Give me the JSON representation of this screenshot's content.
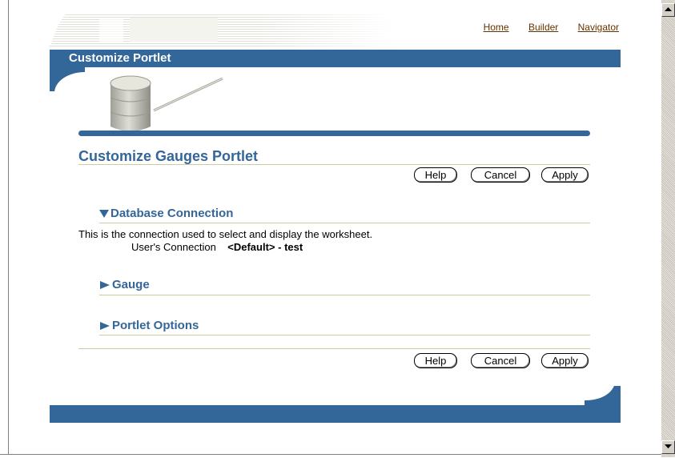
{
  "nav": {
    "home": "Home",
    "builder": "Builder",
    "navigator": "Navigator"
  },
  "title_bar": "Customize Portlet",
  "page_heading": "Customize Gauges Portlet",
  "buttons": {
    "help": "Help",
    "cancel": "Cancel",
    "apply": "Apply"
  },
  "sections": {
    "database": {
      "title": "Database Connection",
      "description": "This is the connection used to select and display the worksheet.",
      "connection_label": "User's Connection",
      "connection_value": "<Default>",
      "connection_suffix": "- test"
    },
    "gauge": {
      "title": "Gauge"
    },
    "portlet_options": {
      "title": "Portlet Options"
    }
  },
  "colors": {
    "brand_blue": "#336699",
    "link_brown": "#663300",
    "rule": "#cccc99"
  },
  "icons": {
    "expanded": "triangle-down-icon",
    "collapsed": "triangle-right-icon",
    "logo": "database-logo-image"
  }
}
